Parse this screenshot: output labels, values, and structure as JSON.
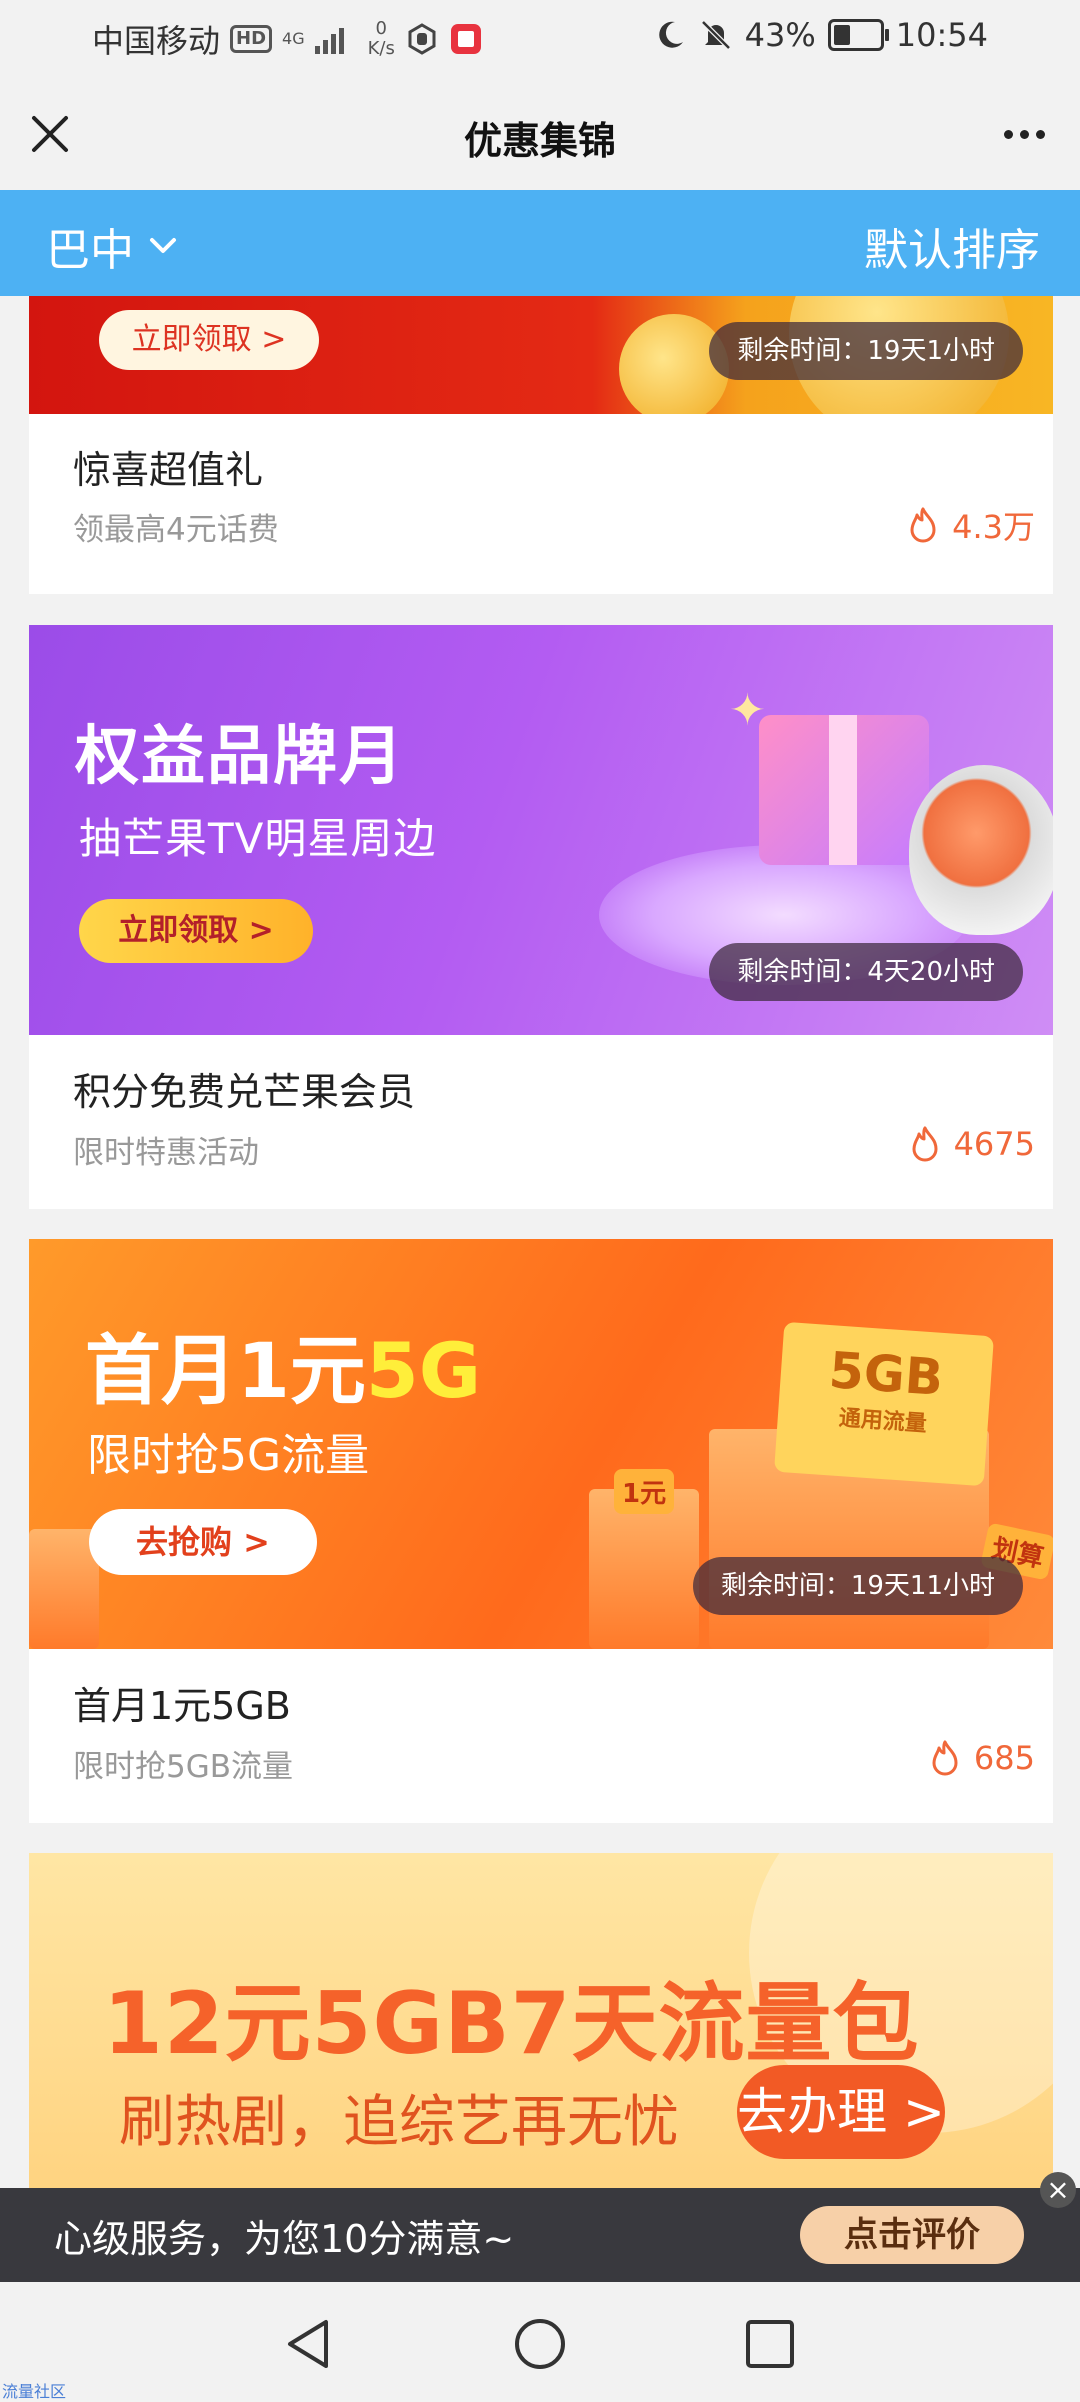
{
  "status_bar": {
    "carrier": "中国移动",
    "hd": "HD",
    "net_type": "4G",
    "speed_value": "0",
    "speed_unit": "K/s",
    "battery": "43%",
    "time": "10:54"
  },
  "header": {
    "title": "优惠集锦"
  },
  "filter_bar": {
    "region": "巴中",
    "sort": "默认排序"
  },
  "offers": [
    {
      "banner": {
        "button": "立即领取 >"
      },
      "remaining": "剩余时间：19天1小时",
      "title": "惊喜超值礼",
      "subtitle": "领最高4元话费",
      "hot": "4.3万"
    },
    {
      "banner": {
        "headline": "权益品牌月",
        "subline": "抽芒果TV明星周边",
        "button": "立即领取 >"
      },
      "remaining": "剩余时间：4天20小时",
      "title": "积分免费兑芒果会员",
      "subtitle": "限时特惠活动",
      "hot": "4675"
    },
    {
      "banner": {
        "headline_a": "首月1元",
        "headline_b": "5G",
        "subline": "限时抢5G流量",
        "button": "去抢购 >",
        "card_big": "5GB",
        "card_small": "通用流量",
        "tag_left": "1元",
        "tag_right": "划算"
      },
      "remaining": "剩余时间：19天11小时",
      "title": "首月1元5GB",
      "subtitle": "限时抢5GB流量",
      "hot": "685"
    },
    {
      "banner": {
        "headline": "12元5GB7天流量包",
        "subline": "刷热剧，追综艺再无忧",
        "button": "去办理 >"
      }
    }
  ],
  "rating_bar": {
    "text": "心级服务，为您10分满意~",
    "button": "点击评价",
    "close": "×"
  },
  "watermark": "流量社区",
  "colors": {
    "accent_blue": "#4db1f3",
    "hot_orange": "#f0683a"
  },
  "icons": [
    "close-icon",
    "more-icon",
    "chevron-down-icon",
    "flame-icon",
    "back-icon",
    "home-icon",
    "recents-icon"
  ]
}
